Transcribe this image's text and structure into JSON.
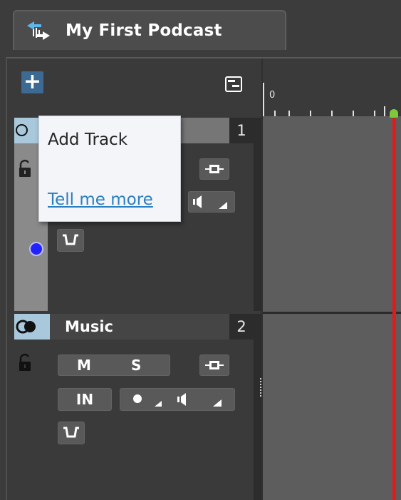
{
  "project": {
    "title": "My First Podcast"
  },
  "ruler": {
    "start_label": "0"
  },
  "tracks": [
    {
      "number": "1",
      "name": ""
    },
    {
      "number": "2",
      "name": "Music",
      "mute_label": "M",
      "solo_label": "S",
      "input_label": "IN"
    }
  ],
  "tooltip": {
    "title": "Add Track",
    "link": "Tell me more"
  },
  "colors": {
    "add_button": "#3d6a93",
    "playhead": "#e11a1a",
    "track1_dot": "#2222ff",
    "link": "#2a7fc1"
  }
}
